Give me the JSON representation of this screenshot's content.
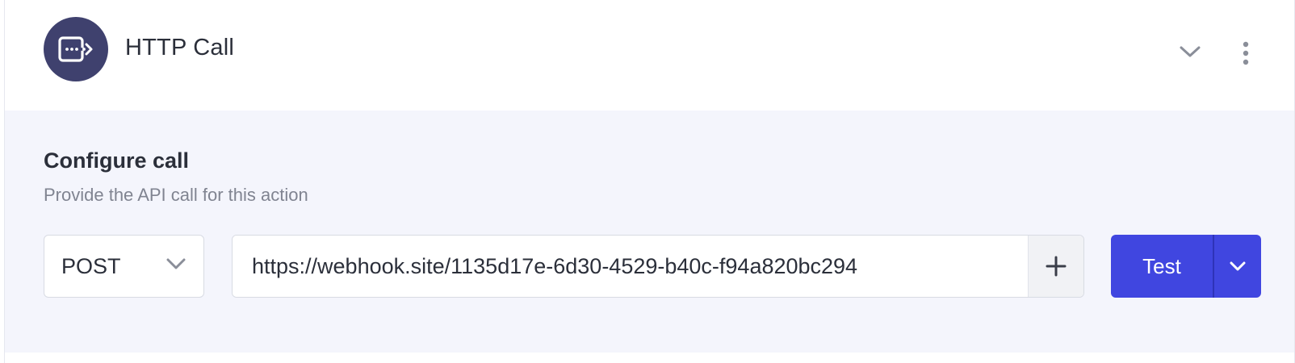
{
  "header": {
    "title": "HTTP Call",
    "icon": "http-call-icon",
    "icon_bg": "#3f416e"
  },
  "configure": {
    "title": "Configure call",
    "subtitle": "Provide the API call for this action"
  },
  "request": {
    "method": "POST",
    "url": "https://webhook.site/1135d17e-6d30-4529-b40c-f94a820bc294"
  },
  "actions": {
    "test_label": "Test",
    "accent": "#4046e0"
  }
}
